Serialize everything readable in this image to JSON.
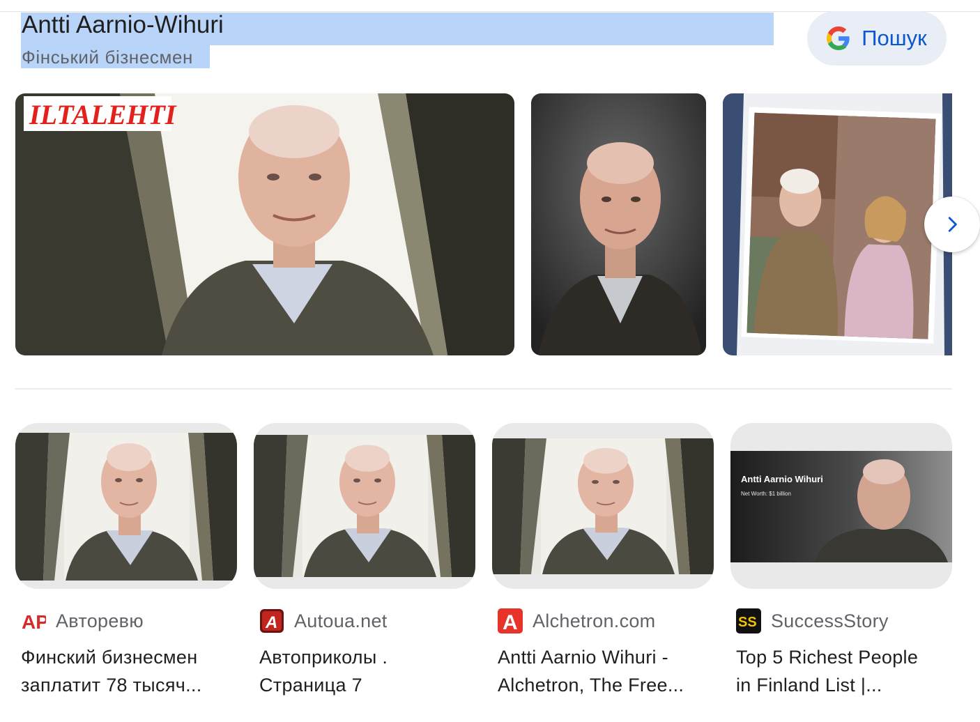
{
  "knowledge_panel": {
    "title": "Antti Aarnio-Wihuri",
    "subtitle": "Фінський бізнесмен",
    "search_button": {
      "label": "Пошук",
      "icon": "google-g-icon"
    }
  },
  "top_images": [
    {
      "watermark": "ILTALEHTI",
      "alt": "portrait"
    },
    {
      "alt": "portrait"
    },
    {
      "alt": "photo"
    }
  ],
  "carousel": {
    "next_icon": "chevron-right-icon"
  },
  "results": [
    {
      "source": "Авторевю",
      "favicon_text": "AP",
      "title_line1": "Финский бизнесмен",
      "title_line2": "заплатит 78 тысяч..."
    },
    {
      "source": "Autoua.net",
      "favicon_text": "A",
      "title_line1": "Автоприколы .",
      "title_line2": "Страница 7"
    },
    {
      "source": "Alchetron.com",
      "favicon_text": "A",
      "title_line1": "Antti Aarnio Wihuri -",
      "title_line2": "Alchetron, The Free..."
    },
    {
      "source": "SuccessStory",
      "favicon_text": "SS",
      "title_line1": "Top 5 Richest People",
      "title_line2": "in Finland List |...",
      "thumb_overlay": {
        "name": "Antti Aarnio Wihuri",
        "net_worth": "Net Worth: $1 billion"
      }
    }
  ],
  "colors": {
    "accent": "#0b57d0",
    "highlight": "#b9d4f9",
    "button_bg": "#e9eef6",
    "iltalehti_red": "#e2211c"
  }
}
